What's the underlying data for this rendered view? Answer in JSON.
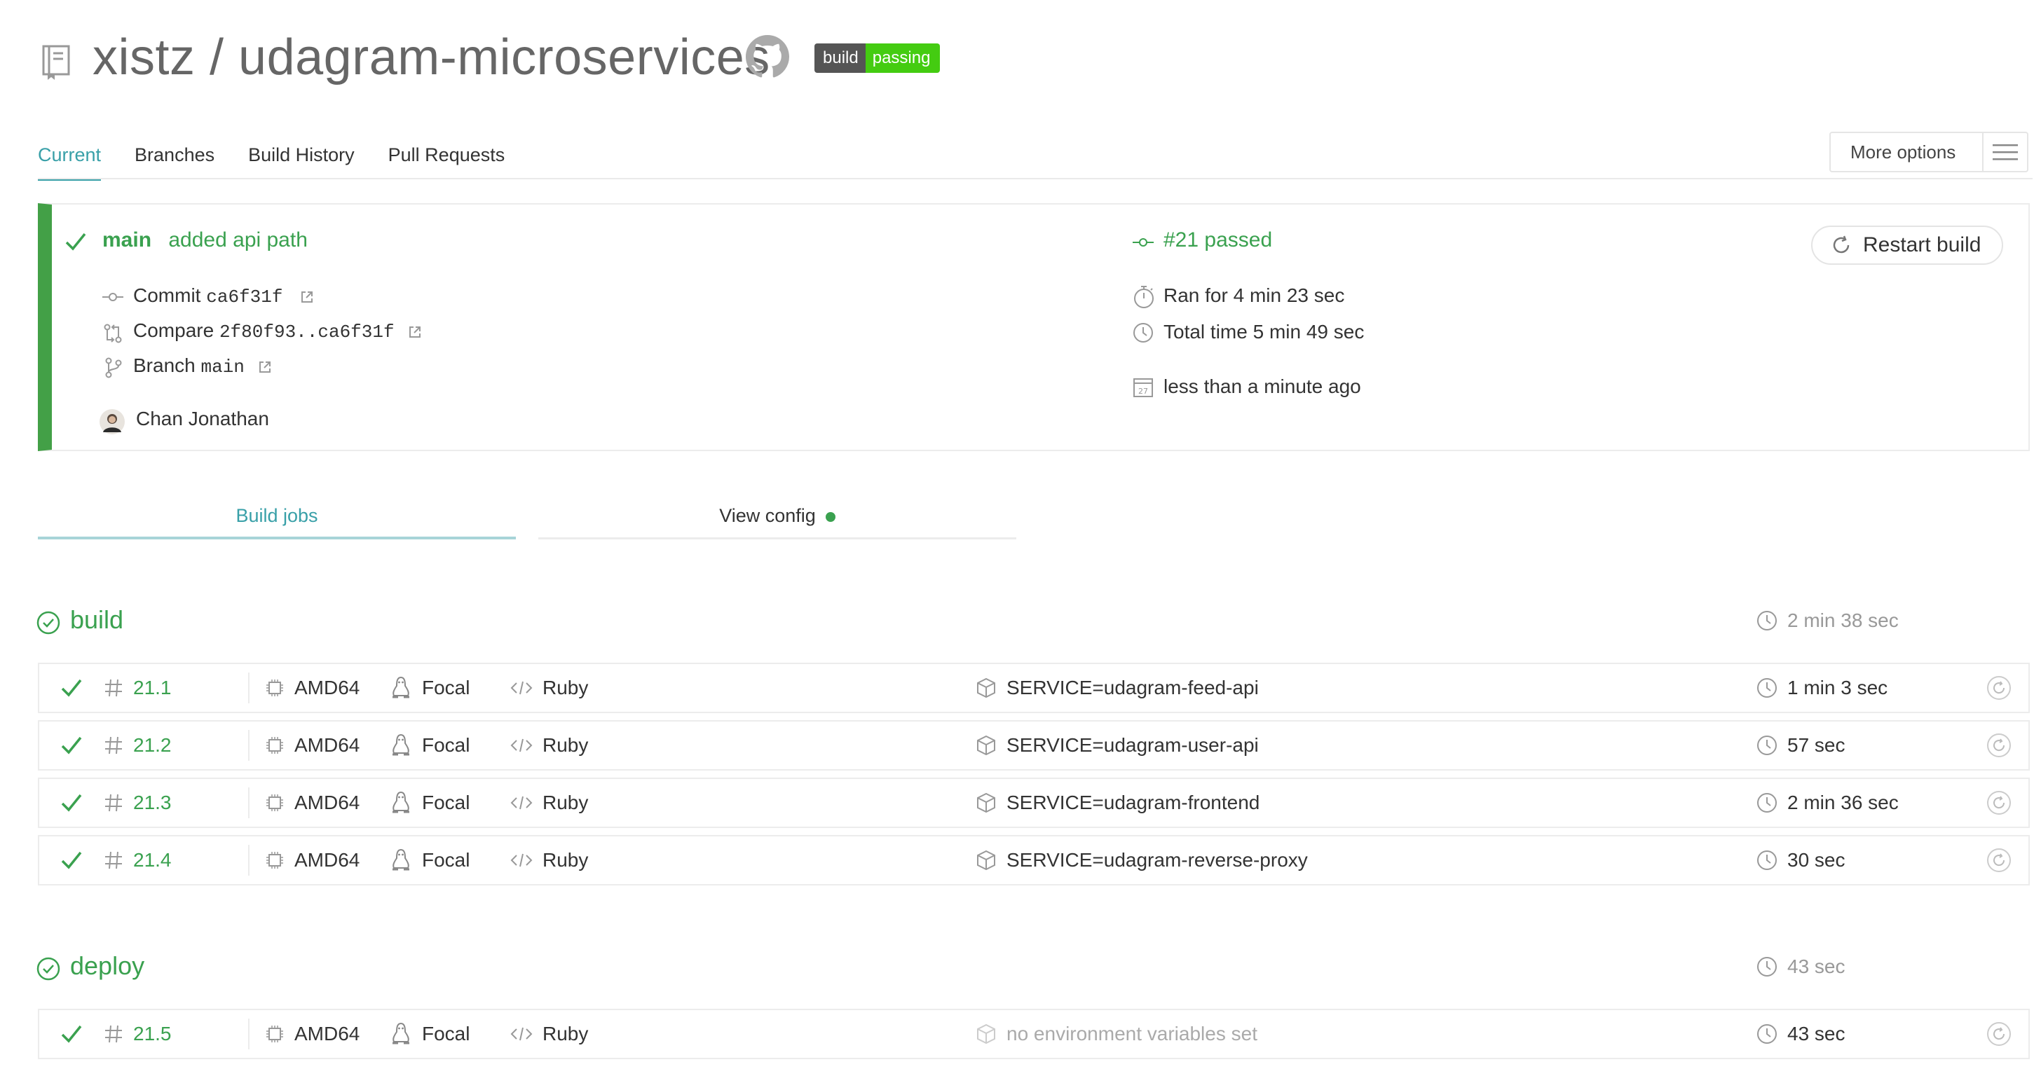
{
  "header": {
    "owner": "xistz",
    "separator": "/",
    "repo": "udagram-microservices",
    "badge": {
      "left": "build",
      "right": "passing"
    }
  },
  "tabs": [
    "Current",
    "Branches",
    "Build History",
    "Pull Requests"
  ],
  "more_options": "More options",
  "summary": {
    "branch": "main",
    "message": "added api path",
    "commit_label": "Commit",
    "commit_hash": "ca6f31f",
    "compare_label": "Compare",
    "compare_range": "2f80f93..ca6f31f",
    "branch_label": "Branch",
    "branch_name": "main",
    "author": "Chan Jonathan",
    "build_status": "#21 passed",
    "ran_for": "Ran for 4 min 23 sec",
    "total_time": "Total time 5 min 49 sec",
    "finished": "less than a minute ago",
    "restart_label": "Restart build",
    "calendar_day": "27"
  },
  "job_tabs": {
    "build_jobs": "Build jobs",
    "view_config": "View config"
  },
  "stages": [
    {
      "name": "build",
      "duration": "2 min 38 sec",
      "jobs": [
        {
          "number": "21.1",
          "arch": "AMD64",
          "os": "Focal",
          "language": "Ruby",
          "env": "SERVICE=udagram-feed-api",
          "duration": "1 min 3 sec"
        },
        {
          "number": "21.2",
          "arch": "AMD64",
          "os": "Focal",
          "language": "Ruby",
          "env": "SERVICE=udagram-user-api",
          "duration": "57 sec"
        },
        {
          "number": "21.3",
          "arch": "AMD64",
          "os": "Focal",
          "language": "Ruby",
          "env": "SERVICE=udagram-frontend",
          "duration": "2 min 36 sec"
        },
        {
          "number": "21.4",
          "arch": "AMD64",
          "os": "Focal",
          "language": "Ruby",
          "env": "SERVICE=udagram-reverse-proxy",
          "duration": "30 sec"
        }
      ]
    },
    {
      "name": "deploy",
      "duration": "43 sec",
      "jobs": [
        {
          "number": "21.5",
          "arch": "AMD64",
          "os": "Focal",
          "language": "Ruby",
          "env": "no environment variables set",
          "duration": "43 sec"
        }
      ]
    }
  ],
  "colors": {
    "accent": "#39a0a8",
    "success": "#3aa14f",
    "badge_green": "#44cc11",
    "badge_dark": "#555555"
  }
}
